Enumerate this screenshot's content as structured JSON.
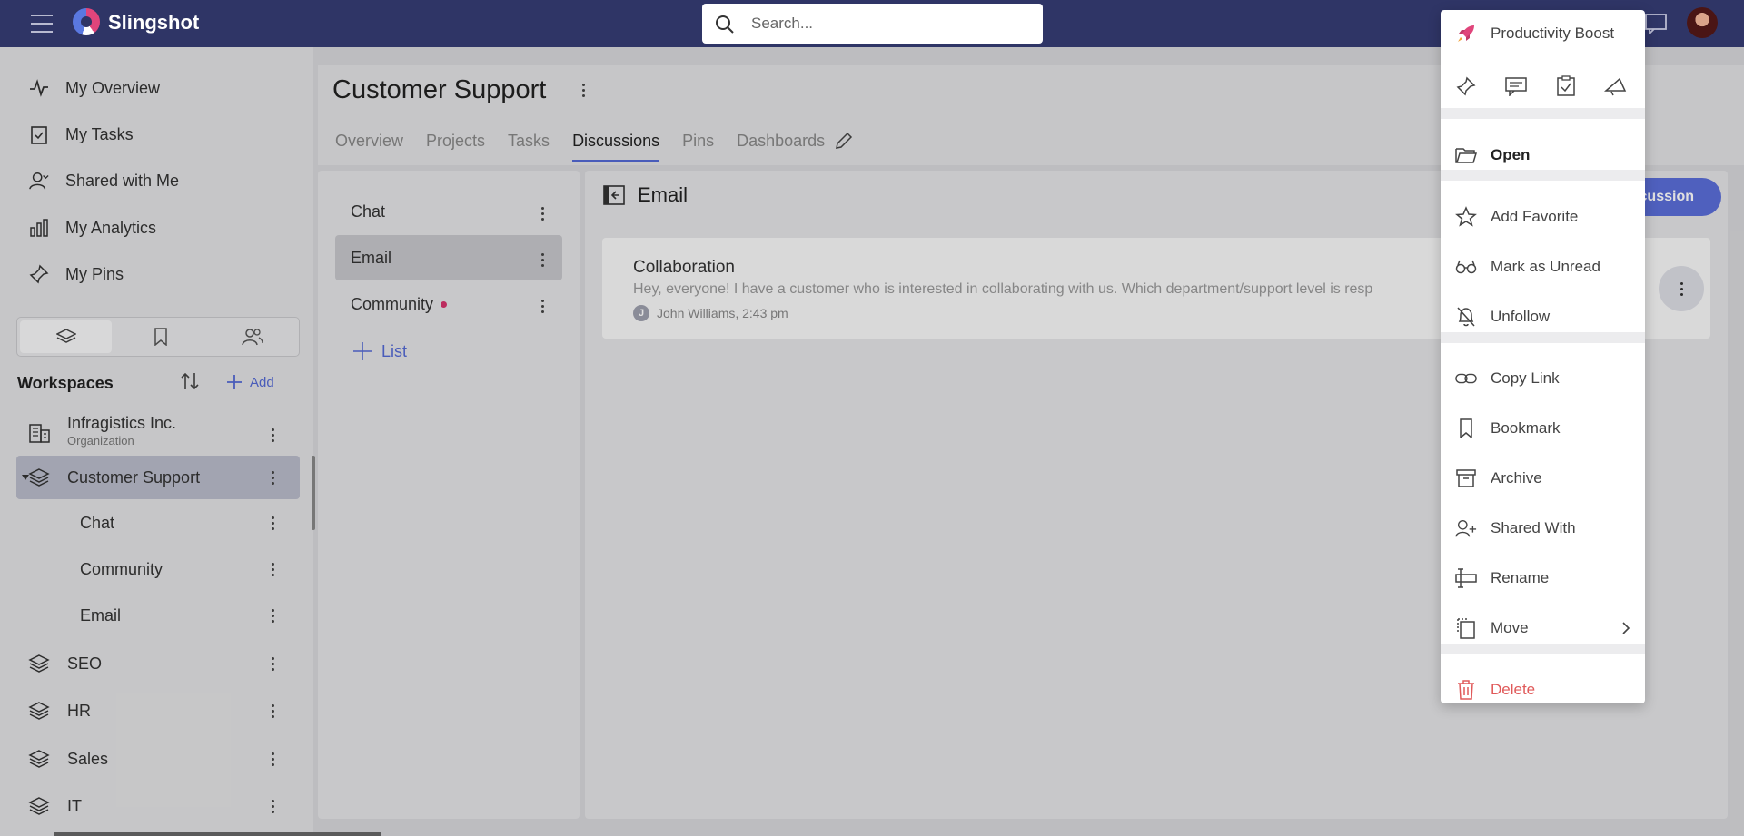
{
  "app": {
    "brand": "Slingshot"
  },
  "search": {
    "placeholder": "Search..."
  },
  "nav": [
    {
      "label": "My Overview",
      "icon": "activity-icon"
    },
    {
      "label": "My Tasks",
      "icon": "task-icon"
    },
    {
      "label": "Shared with Me",
      "icon": "shared-users-icon"
    },
    {
      "label": "My Analytics",
      "icon": "analytics-icon"
    },
    {
      "label": "My Pins",
      "icon": "pin-icon"
    }
  ],
  "workspaces": {
    "title": "Workspaces",
    "add_label": "Add",
    "items": [
      {
        "label": "Infragistics Inc.",
        "sub": "Organization"
      },
      {
        "label": "Customer Support"
      },
      {
        "label": "Chat"
      },
      {
        "label": "Community"
      },
      {
        "label": "Email"
      },
      {
        "label": "SEO"
      },
      {
        "label": "HR"
      },
      {
        "label": "Sales"
      },
      {
        "label": "IT"
      }
    ]
  },
  "header": {
    "title": "Customer Support",
    "tabs": [
      "Overview",
      "Projects",
      "Tasks",
      "Discussions",
      "Pins",
      "Dashboards"
    ],
    "active_tab": "Discussions"
  },
  "lists": {
    "items": [
      {
        "label": "Chat"
      },
      {
        "label": "Email"
      },
      {
        "label": "Community"
      }
    ],
    "add_label": "List"
  },
  "discussion": {
    "title": "Email",
    "new_button": "cussion",
    "card": {
      "title": "Collaboration",
      "body": "Hey, everyone! I have a customer who is interested in collaborating with us. Which department/support level is resp",
      "author_initial": "J",
      "meta": "John Williams, 2:43 pm"
    }
  },
  "menu": {
    "header": "Productivity Boost",
    "items": {
      "open": "Open",
      "add_favorite": "Add Favorite",
      "mark_unread": "Mark as Unread",
      "unfollow": "Unfollow",
      "copy_link": "Copy Link",
      "bookmark": "Bookmark",
      "archive": "Archive",
      "shared_with": "Shared With",
      "rename": "Rename",
      "move": "Move",
      "delete": "Delete"
    }
  },
  "colors": {
    "topbar": "#2f3566",
    "accent": "#5469d4",
    "danger": "#e05a5a",
    "unread_dot": "#d6336c"
  }
}
